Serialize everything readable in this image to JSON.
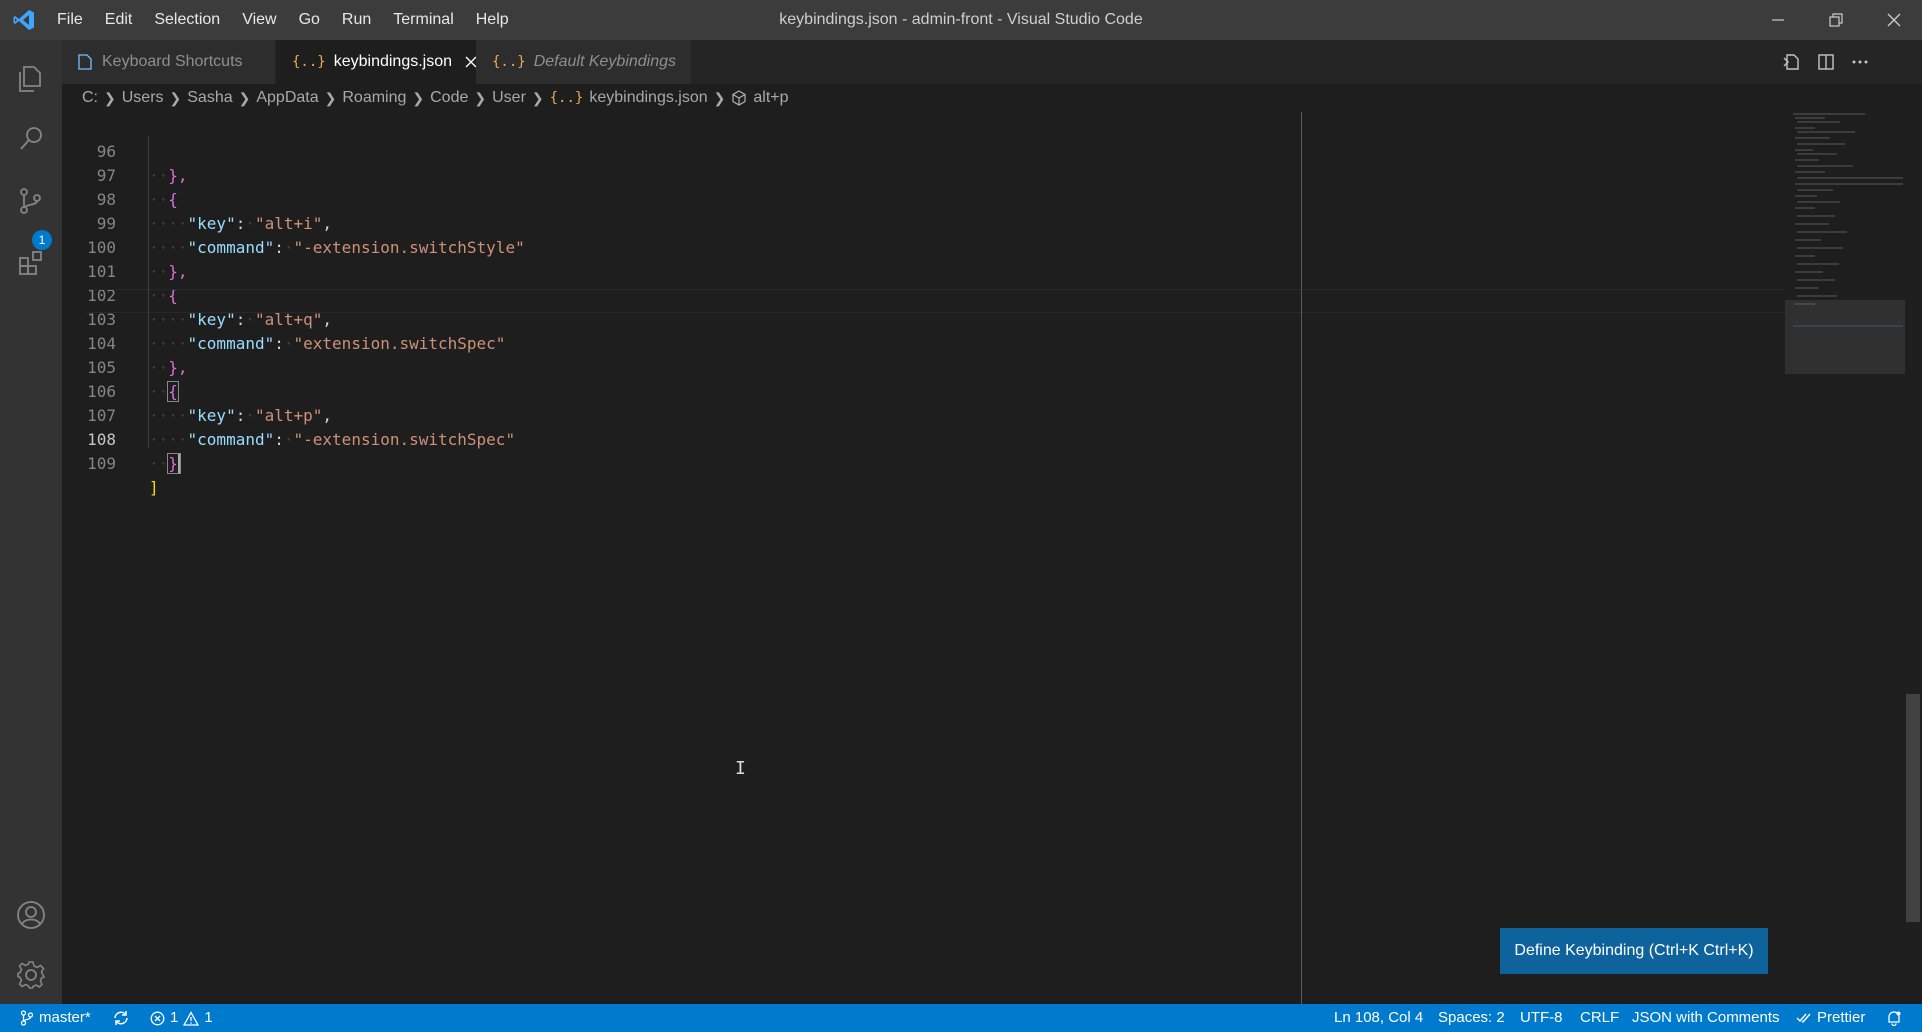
{
  "window": {
    "title": "keybindings.json - admin-front - Visual Studio Code",
    "menu": [
      "File",
      "Edit",
      "Selection",
      "View",
      "Go",
      "Run",
      "Terminal",
      "Help"
    ]
  },
  "activity_bar": {
    "items": [
      "explorer-icon",
      "search-icon",
      "source-control-icon",
      "extensions-icon"
    ],
    "scm_badge": "1",
    "bottom_items": [
      "accounts-icon",
      "settings-gear-icon"
    ]
  },
  "tabs": [
    {
      "label": "Keyboard Shortcuts",
      "icon": "keyboard-shortcuts-icon",
      "active": false
    },
    {
      "label": "keybindings.json",
      "icon": "{..}",
      "active": true
    },
    {
      "label": "Default Keybindings",
      "icon": "{..}",
      "active": false
    }
  ],
  "breadcrumb": [
    "C:",
    "Users",
    "Sasha",
    "AppData",
    "Roaming",
    "Code",
    "User",
    "keybindings.json",
    "alt+p"
  ],
  "editor": {
    "lines": [
      {
        "num": "96",
        "text": "},"
      },
      {
        "num": "97",
        "text": "{"
      },
      {
        "num": "98",
        "key": "\"key\"",
        "value": "\"alt+i\"",
        "trail": ","
      },
      {
        "num": "99",
        "key": "\"command\"",
        "value": "\"-extension.switchStyle\"",
        "trail": ""
      },
      {
        "num": "100",
        "text": "},"
      },
      {
        "num": "101",
        "text": "{"
      },
      {
        "num": "102",
        "key": "\"key\"",
        "value": "\"alt+q\"",
        "trail": ","
      },
      {
        "num": "103",
        "key": "\"command\"",
        "value": "\"extension.switchSpec\"",
        "trail": ""
      },
      {
        "num": "104",
        "text": "},"
      },
      {
        "num": "105",
        "text": "{"
      },
      {
        "num": "106",
        "key": "\"key\"",
        "value": "\"alt+p\"",
        "trail": ","
      },
      {
        "num": "107",
        "key": "\"command\"",
        "value": "\"-extension.switchSpec\"",
        "trail": ""
      },
      {
        "num": "108",
        "text": "}"
      },
      {
        "num": "109",
        "text": "]"
      }
    ],
    "current_line": "108"
  },
  "define_keybinding": "Define Keybinding (Ctrl+K Ctrl+K)",
  "status_bar": {
    "branch": "master*",
    "errors": "1",
    "warnings": "1",
    "position": "Ln 108, Col 4",
    "spaces": "Spaces: 2",
    "encoding": "UTF-8",
    "eol": "CRLF",
    "language": "JSON with Comments",
    "formatter": "Prettier"
  },
  "colors": {
    "accent": "#007acc",
    "titlebar": "#3c3c3c",
    "editor_bg": "#1e1e1e"
  }
}
